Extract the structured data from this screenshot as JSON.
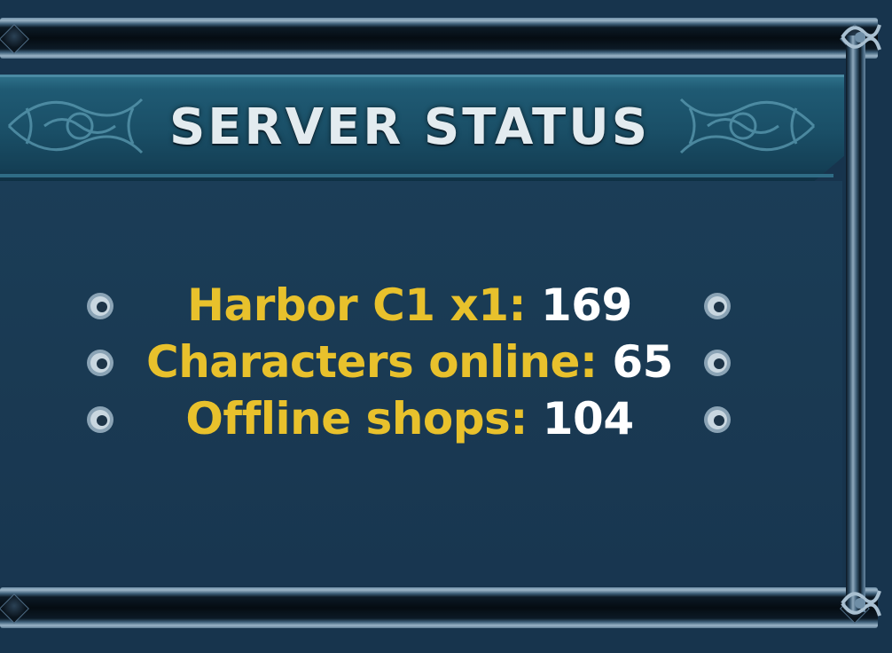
{
  "header": {
    "title": "SERVER STATUS"
  },
  "stats": [
    {
      "label": "Harbor C1 x1:",
      "value": "169"
    },
    {
      "label": "Characters online:",
      "value": "65"
    },
    {
      "label": "Offline shops:",
      "value": "104"
    }
  ],
  "icons": {
    "bullet": "round-stud-icon",
    "header_ornament": "scroll-ornament-icon",
    "corner": "corner-ornament-icon"
  },
  "colors": {
    "label": "#e8c12c",
    "value": "#ffffff",
    "title": "#e3ebef",
    "panel": "#1a3a53",
    "banner": "#1f5a73"
  }
}
